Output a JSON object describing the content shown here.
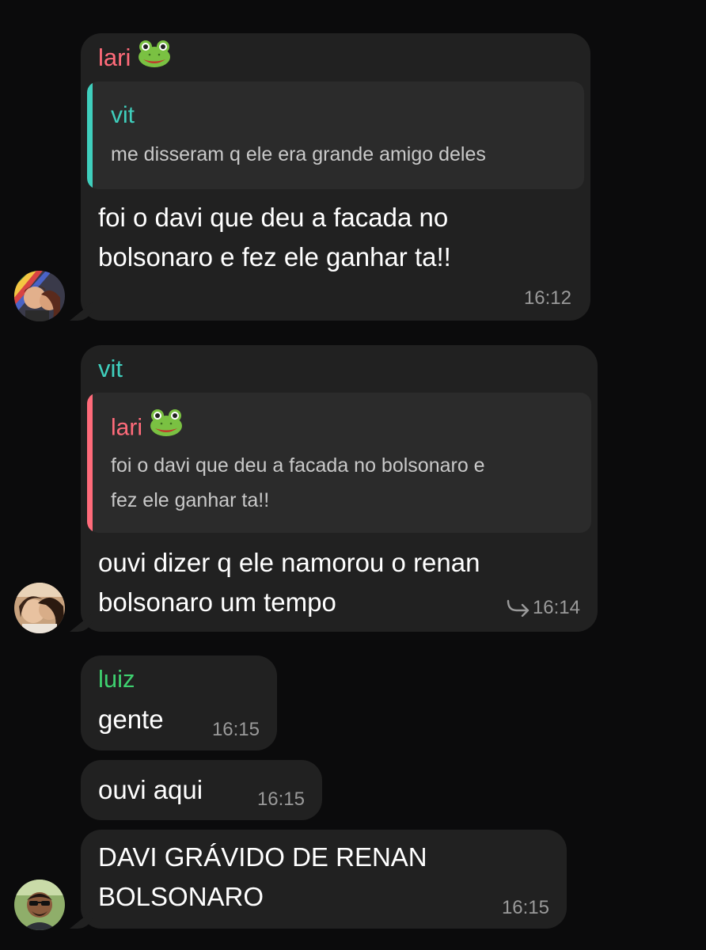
{
  "colors": {
    "background": "#0b0b0c",
    "bubble": "#212121",
    "quote_bg": "#2b2b2b",
    "name_lari": "#ff6b7a",
    "name_vit": "#3fcfbd",
    "name_luiz": "#3ed06f",
    "timestamp": "#9a9a9a"
  },
  "messages": [
    {
      "sender": "lari",
      "sender_emoji_icon": "frog-face-icon",
      "reply": {
        "name": "vit",
        "text": "me disseram q ele era grande amigo deles"
      },
      "text_lines": [
        "foi o davi que deu a facada no",
        "bolsonaro e fez ele ganhar ta!!"
      ],
      "time": "16:12"
    },
    {
      "sender": "vit",
      "reply": {
        "name": "lari",
        "name_emoji_icon": "frog-face-icon",
        "text_lines": [
          "foi o davi que deu a facada no bolsonaro e",
          "fez ele ganhar ta!!"
        ]
      },
      "text_lines": [
        "ouvi dizer q ele namorou o renan",
        "bolsonaro um tempo"
      ],
      "time": "16:14",
      "reply_arrow_icon": "forward-arrow-icon"
    },
    {
      "sender": "luiz",
      "text": "gente",
      "time": "16:15"
    },
    {
      "text": "ouvi aqui",
      "time": "16:15"
    },
    {
      "text_lines": [
        "DAVI GRÁVIDO DE RENAN",
        "BOLSONARO"
      ],
      "time": "16:15"
    }
  ]
}
